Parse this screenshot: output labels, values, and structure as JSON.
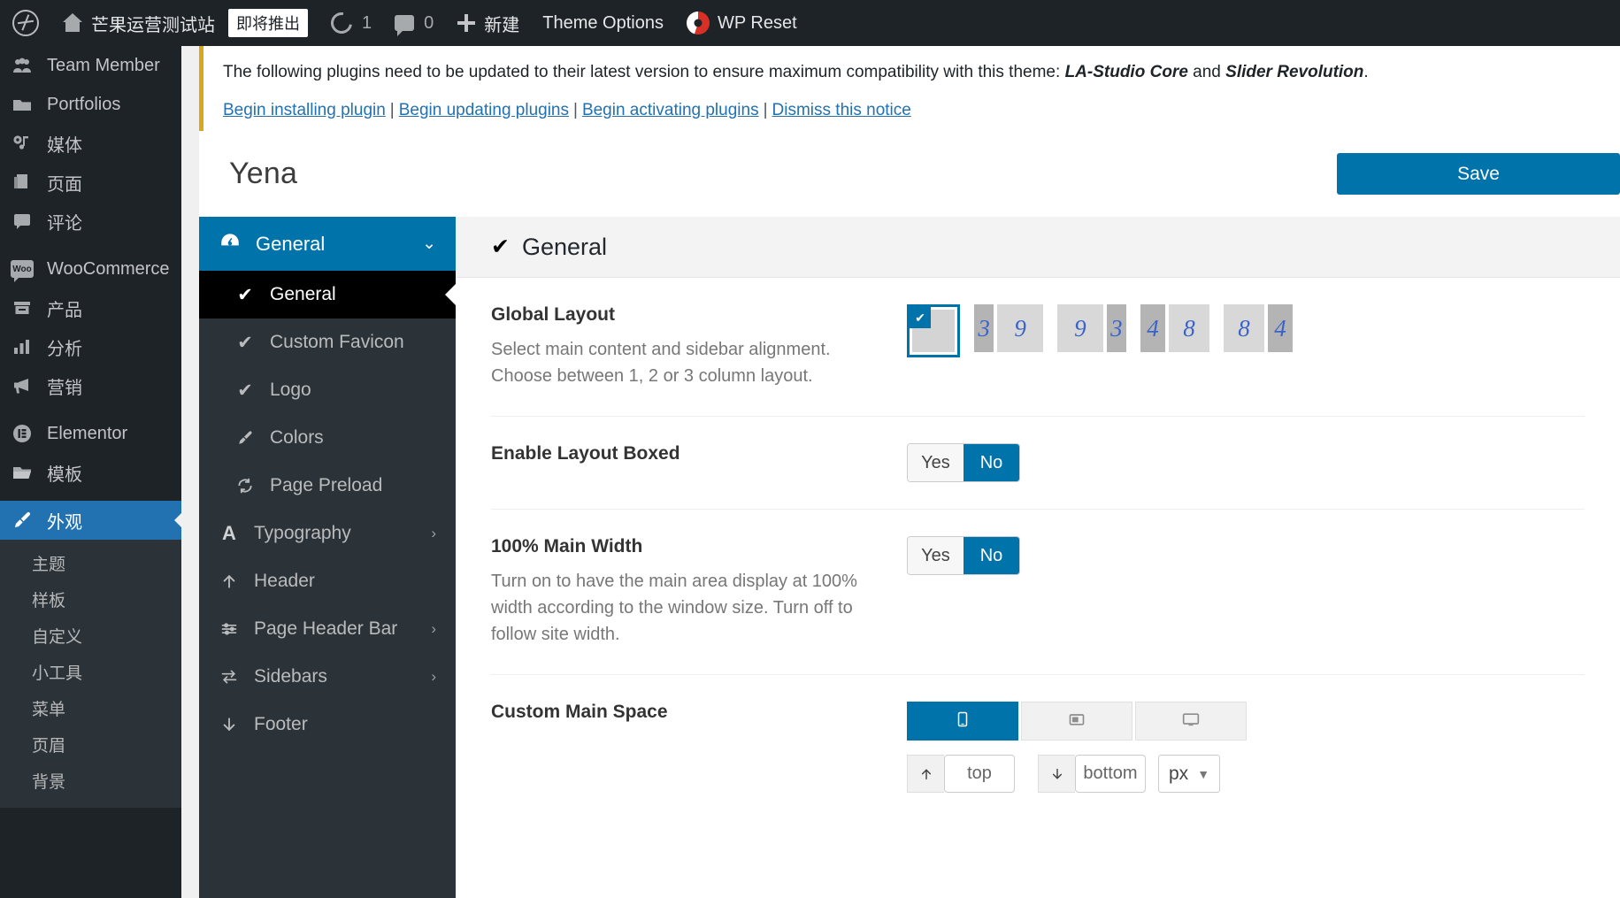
{
  "adminbar": {
    "logo_icon": "wordpress-logo-icon",
    "home_icon": "home-icon",
    "site_name": "芒果运营测试站",
    "coming_soon_badge": "即将推出",
    "updates_icon": "updates-icon",
    "updates_count": "1",
    "comments_icon": "comments-icon",
    "comments_count": "0",
    "new_icon": "plus-icon",
    "new_label": "新建",
    "theme_options_label": "Theme Options",
    "wp_reset_icon": "wp-reset-icon",
    "wp_reset_label": "WP Reset"
  },
  "adminmenu": {
    "items": [
      {
        "label": "Team Member",
        "icon": "groups-icon"
      },
      {
        "label": "Portfolios",
        "icon": "portfolio-icon"
      },
      {
        "label": "媒体",
        "icon": "media-icon"
      },
      {
        "label": "页面",
        "icon": "pages-icon"
      },
      {
        "label": "评论",
        "icon": "comments-icon"
      },
      {
        "label": "WooCommerce",
        "icon": "woo-icon"
      },
      {
        "label": "产品",
        "icon": "products-icon"
      },
      {
        "label": "分析",
        "icon": "analytics-icon"
      },
      {
        "label": "营销",
        "icon": "marketing-icon"
      },
      {
        "label": "Elementor",
        "icon": "elementor-icon"
      },
      {
        "label": "模板",
        "icon": "templates-icon"
      },
      {
        "label": "外观",
        "icon": "appearance-brush-icon",
        "current": true
      }
    ],
    "appearance_submenu": [
      "主题",
      "样板",
      "自定义",
      "小工具",
      "菜单",
      "页眉",
      "背景"
    ]
  },
  "notice": {
    "text_before": "The following plugins need to be updated to their latest version to ensure maximum compatibility with this theme: ",
    "plugin_one": "LA-Studio Core",
    "text_and": " and ",
    "plugin_two": "Slider Revolution",
    "text_after": ".",
    "links": [
      "Begin installing plugin",
      "Begin updating plugins",
      "Begin activating plugins",
      "Dismiss this notice"
    ]
  },
  "panel": {
    "title": "Yena",
    "save_label": "Save",
    "nav": {
      "group_label": "General",
      "group_icon": "dashboard-gauge-icon",
      "chevron_icon": "chevron-down-icon",
      "items": [
        {
          "label": "General",
          "icon": "check-icon",
          "active": true,
          "arrow": ""
        },
        {
          "label": "Custom Favicon",
          "icon": "check-icon",
          "active": false,
          "arrow": ""
        },
        {
          "label": "Logo",
          "icon": "check-icon",
          "active": false,
          "arrow": ""
        },
        {
          "label": "Colors",
          "icon": "brush-icon",
          "active": false,
          "arrow": ""
        },
        {
          "label": "Page Preload",
          "icon": "refresh-icon",
          "active": false,
          "arrow": ""
        },
        {
          "label": "Typography",
          "icon": "letter-a-icon",
          "active": false,
          "arrow": "›"
        },
        {
          "label": "Header",
          "icon": "arrow-up-icon",
          "active": false,
          "arrow": ""
        },
        {
          "label": "Page Header Bar",
          "icon": "sliders-icon",
          "active": false,
          "arrow": "›"
        },
        {
          "label": "Sidebars",
          "icon": "swap-arrows-icon",
          "active": false,
          "arrow": "›"
        },
        {
          "label": "Footer",
          "icon": "arrow-down-icon",
          "active": false,
          "arrow": ""
        }
      ]
    },
    "section": {
      "heading": "General",
      "heading_icon": "check-icon",
      "fields": [
        {
          "title": "Global Layout",
          "desc": "Select main content and sidebar alignment. Choose between 1, 2 or 3 column layout.",
          "type": "layout",
          "selected_index": 0,
          "options": [
            {
              "kind": "full",
              "cols": []
            },
            {
              "kind": "split",
              "cols": [
                "3",
                "9"
              ],
              "shades": [
                "dark",
                "light"
              ]
            },
            {
              "kind": "split",
              "cols": [
                "9",
                "3"
              ],
              "shades": [
                "light",
                "dark"
              ]
            },
            {
              "kind": "split",
              "cols": [
                "4",
                "8"
              ],
              "shades": [
                "dark",
                "light"
              ]
            },
            {
              "kind": "split",
              "cols": [
                "8",
                "4"
              ],
              "shades": [
                "light",
                "dark"
              ]
            }
          ]
        },
        {
          "title": "Enable Layout Boxed",
          "desc": "",
          "type": "switch",
          "yes_label": "Yes",
          "no_label": "No",
          "value": "No"
        },
        {
          "title": "100% Main Width",
          "desc": "Turn on to have the main area display at 100% width according to the window size. Turn off to follow site width.",
          "type": "switch",
          "yes_label": "Yes",
          "no_label": "No",
          "value": "No"
        },
        {
          "title": "Custom Main Space",
          "desc": "",
          "type": "spacing",
          "tabs": [
            {
              "icon": "mobile-icon",
              "active": true
            },
            {
              "icon": "tablet-icon",
              "active": false
            },
            {
              "icon": "desktop-icon",
              "active": false
            }
          ],
          "top_prefix_icon": "arrow-up-icon",
          "top_placeholder": "top",
          "top_value": "",
          "bottom_prefix_icon": "arrow-down-icon",
          "bottom_placeholder": "bottom",
          "bottom_value": "",
          "unit": "px",
          "unit_caret_icon": "caret-down-icon"
        }
      ]
    }
  },
  "colors": {
    "accent": "#0073aa",
    "admin_dark": "#1d2327",
    "admin_submenu": "#2c3338",
    "current_blue": "#2271b1",
    "notice_accent": "#dba617",
    "link": "#2271b1"
  }
}
